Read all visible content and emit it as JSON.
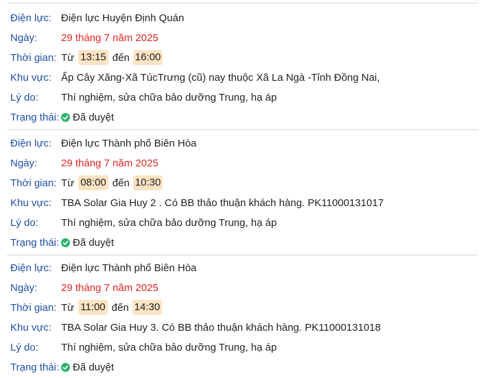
{
  "labels": {
    "unit": "Điện lực:",
    "date": "Ngày:",
    "time": "Thời gian:",
    "area": "Khu vực:",
    "reason": "Lý do:",
    "status": "Trạng thái:",
    "from": "Từ",
    "to": "đến"
  },
  "records": [
    {
      "unit": "Điện lực Huyện Định Quán",
      "date": "29 tháng 7 năm 2025",
      "time_from": "13:15",
      "time_to": "16:00",
      "area": "Ấp Cây Xăng-Xã TúcTrưng (cũ) nay thuộc Xã La Ngà -Tỉnh Đồng Nai,",
      "reason": "Thí nghiệm, sửa chữa bảo dưỡng Trung, hạ áp",
      "status": "Đã duyệt"
    },
    {
      "unit": "Điện lực Thành phố Biên Hòa",
      "date": "29 tháng 7 năm 2025",
      "time_from": "08:00",
      "time_to": "10:30",
      "area": "TBA Solar Gia Huy 2 . Có BB thảo thuận khách hàng. PK11000131017",
      "reason": "Thí nghiệm, sửa chữa bảo dưỡng Trung, hạ áp",
      "status": "Đã duyệt"
    },
    {
      "unit": "Điện lực Thành phố Biên Hòa",
      "date": "29 tháng 7 năm 2025",
      "time_from": "11:00",
      "time_to": "14:30",
      "area": "TBA Solar Gia Huy 3. Có BB thảo thuận khách hàng. PK11000131018",
      "reason": "Thí nghiệm, sửa chữa bảo dưỡng Trung, hạ áp",
      "status": "Đã duyệt"
    }
  ],
  "colors": {
    "label": "#1f4fa8",
    "date": "#e02424",
    "chip_bg": "#fbe3c3",
    "status_icon": "#2fb36d"
  },
  "icons": {
    "status": "check-circle-icon"
  }
}
